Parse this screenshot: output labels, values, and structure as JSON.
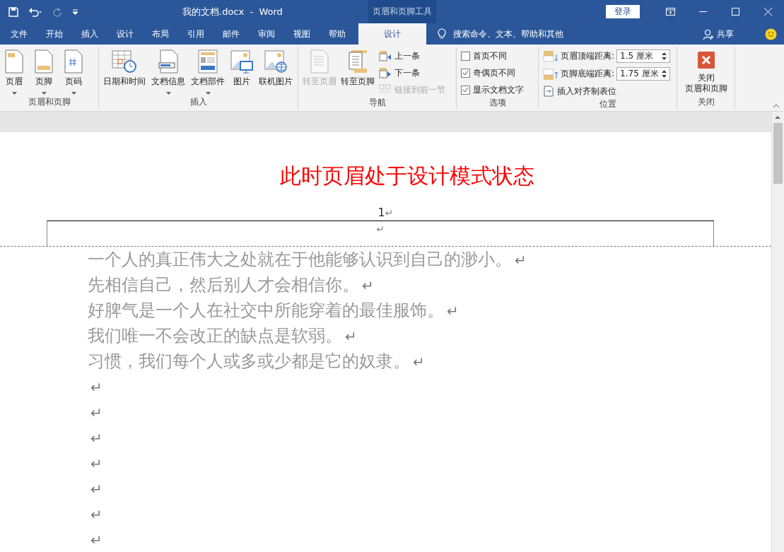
{
  "title_bar": {
    "title": "我的文档.docx  -  Word",
    "context_label": "页眉和页脚工具",
    "login": "登录"
  },
  "tabs": [
    {
      "label": "文件",
      "selected": false
    },
    {
      "label": "开始",
      "selected": false
    },
    {
      "label": "插入",
      "selected": false
    },
    {
      "label": "设计",
      "selected": false
    },
    {
      "label": "布局",
      "selected": false
    },
    {
      "label": "引用",
      "selected": false
    },
    {
      "label": "邮件",
      "selected": false
    },
    {
      "label": "审阅",
      "selected": false
    },
    {
      "label": "视图",
      "selected": false
    },
    {
      "label": "帮助",
      "selected": false
    },
    {
      "label": "设计",
      "selected": true,
      "contextual": true
    }
  ],
  "search": {
    "placeholder": "搜索命令、文本、帮助和其他"
  },
  "share": "共享",
  "ribbon": {
    "groups": [
      {
        "label": "页眉和页脚",
        "items": [
          {
            "kind": "large",
            "label": "页眉",
            "dropdown": true,
            "disabled": false
          },
          {
            "kind": "large",
            "label": "页脚",
            "dropdown": true,
            "disabled": false
          },
          {
            "kind": "large",
            "label": "页码",
            "dropdown": true,
            "disabled": false
          }
        ]
      },
      {
        "label": "插入",
        "items": [
          {
            "kind": "large",
            "label": "日期和时间",
            "dropdown": false,
            "disabled": false
          },
          {
            "kind": "large",
            "label": "文档信息",
            "dropdown": true,
            "disabled": false
          },
          {
            "kind": "large",
            "label": "文档部件",
            "dropdown": true,
            "disabled": false
          },
          {
            "kind": "large",
            "label": "图片",
            "dropdown": false,
            "disabled": false
          },
          {
            "kind": "large",
            "label": "联机图片",
            "dropdown": false,
            "disabled": false
          }
        ]
      },
      {
        "label": "导航",
        "items": [
          {
            "kind": "large",
            "label": "转至页眉",
            "dropdown": false,
            "disabled": true
          },
          {
            "kind": "large",
            "label": "转至页脚",
            "dropdown": false,
            "disabled": false
          },
          {
            "kind": "small",
            "label": "上一条",
            "disabled": false
          },
          {
            "kind": "small",
            "label": "下一条",
            "disabled": false
          },
          {
            "kind": "small",
            "label": "链接到前一节",
            "disabled": true
          }
        ]
      },
      {
        "label": "选项",
        "items": [
          {
            "kind": "checkbox",
            "label": "首页不同",
            "checked": false
          },
          {
            "kind": "checkbox",
            "label": "奇偶页不同",
            "checked": true
          },
          {
            "kind": "checkbox",
            "label": "显示文档文字",
            "checked": true
          }
        ]
      },
      {
        "label": "位置",
        "items": [
          {
            "kind": "spinner",
            "label": "页眉顶端距离:",
            "value": "1.5 厘米"
          },
          {
            "kind": "spinner",
            "label": "页脚底端距离:",
            "value": "1.75 厘米"
          },
          {
            "kind": "small",
            "label": "插入对齐制表位",
            "disabled": false
          }
        ]
      },
      {
        "label": "关闭",
        "items": [
          {
            "kind": "close",
            "lines": [
              "关闭",
              "页眉和页脚"
            ]
          }
        ]
      }
    ]
  },
  "document": {
    "heading": "此时页眉处于设计模式状态",
    "header_lines": [
      {
        "text": "1",
        "mark": "↵"
      },
      {
        "mark": "↵"
      }
    ],
    "paragraphs": [
      {
        "text": "一个人的真正伟大之处就在于他能够认识到自己的渺小。",
        "mark": "↵"
      },
      {
        "text": "先相信自己，然后别人才会相信你。",
        "mark": "↵"
      },
      {
        "text": "好脾气是一个人在社交中所能穿着的最佳服饰。",
        "mark": "↵"
      },
      {
        "text": "我们唯一不会改正的缺点是软弱。",
        "mark": "↵"
      },
      {
        "text": "习惯，我们每个人或多或少都是它的奴隶。",
        "mark": "↵"
      },
      {
        "mark": "↵"
      },
      {
        "mark": "↵"
      },
      {
        "mark": "↵"
      },
      {
        "mark": "↵"
      },
      {
        "mark": "↵"
      },
      {
        "mark": "↵"
      },
      {
        "mark": "↵"
      }
    ]
  }
}
